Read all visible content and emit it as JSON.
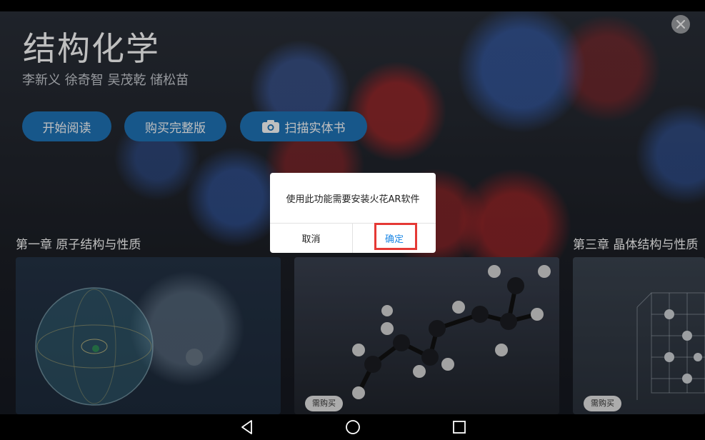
{
  "book": {
    "title": "结构化学",
    "authors": "李新义 徐奇智 吴茂乾 储松苗"
  },
  "actions": {
    "read_label": "开始阅读",
    "buy_label": "购买完整版",
    "scan_label": "扫描实体书"
  },
  "chapters": {
    "left_title": "第一章 原子结构与性质",
    "right_title": "第三章 晶体结构与性质",
    "badge_label": "需购买"
  },
  "dialog": {
    "message": "使用此功能需要安装火花AR软件",
    "cancel_label": "取消",
    "confirm_label": "确定"
  },
  "colors": {
    "primary_button": "#1f74b9",
    "confirm_text": "#1e88e5",
    "highlight_border": "#e53935"
  },
  "icons": {
    "close": "close-icon",
    "camera": "camera-icon",
    "nav_back": "back-triangle-icon",
    "nav_home": "home-circle-icon",
    "nav_recent": "recent-square-icon"
  }
}
